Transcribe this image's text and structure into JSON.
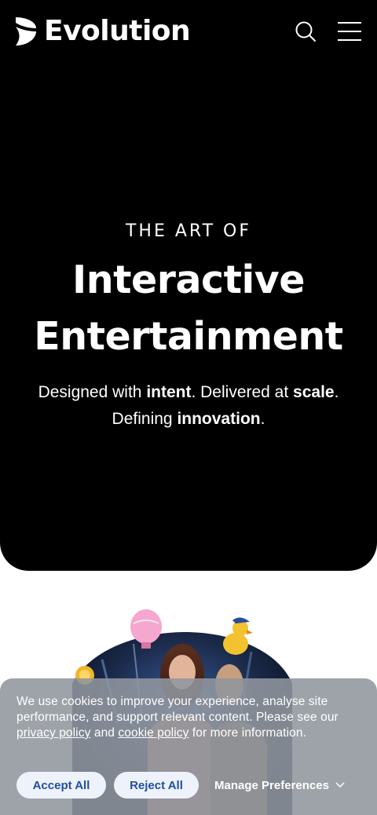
{
  "header": {
    "logo_text": "Evolution",
    "search_icon": "search-icon",
    "menu_icon": "hamburger-menu-icon"
  },
  "hero": {
    "kicker": "THE ART OF",
    "headline_line1": "Interactive",
    "headline_line2": "Entertainment",
    "sub_1a": "Designed with ",
    "sub_1b": "intent",
    "sub_1c": ". Delivered at ",
    "sub_1d": "scale",
    "sub_1e": ".",
    "sub_2a": "Defining ",
    "sub_2b": "innovation",
    "sub_2c": "."
  },
  "cookie_banner": {
    "text_1": "We use cookies to improve your experience, analyse site performance, and support relevant content. Please see our ",
    "privacy_link": "privacy policy",
    "text_2": " and ",
    "cookie_link": "cookie policy",
    "text_3": " for more information.",
    "accept_label": "Accept All",
    "reject_label": "Reject All",
    "manage_label": "Manage Preferences"
  },
  "colors": {
    "hero_bg": "#000000",
    "button_text": "#1f4fa3",
    "button_bg": "#eef2fb"
  }
}
